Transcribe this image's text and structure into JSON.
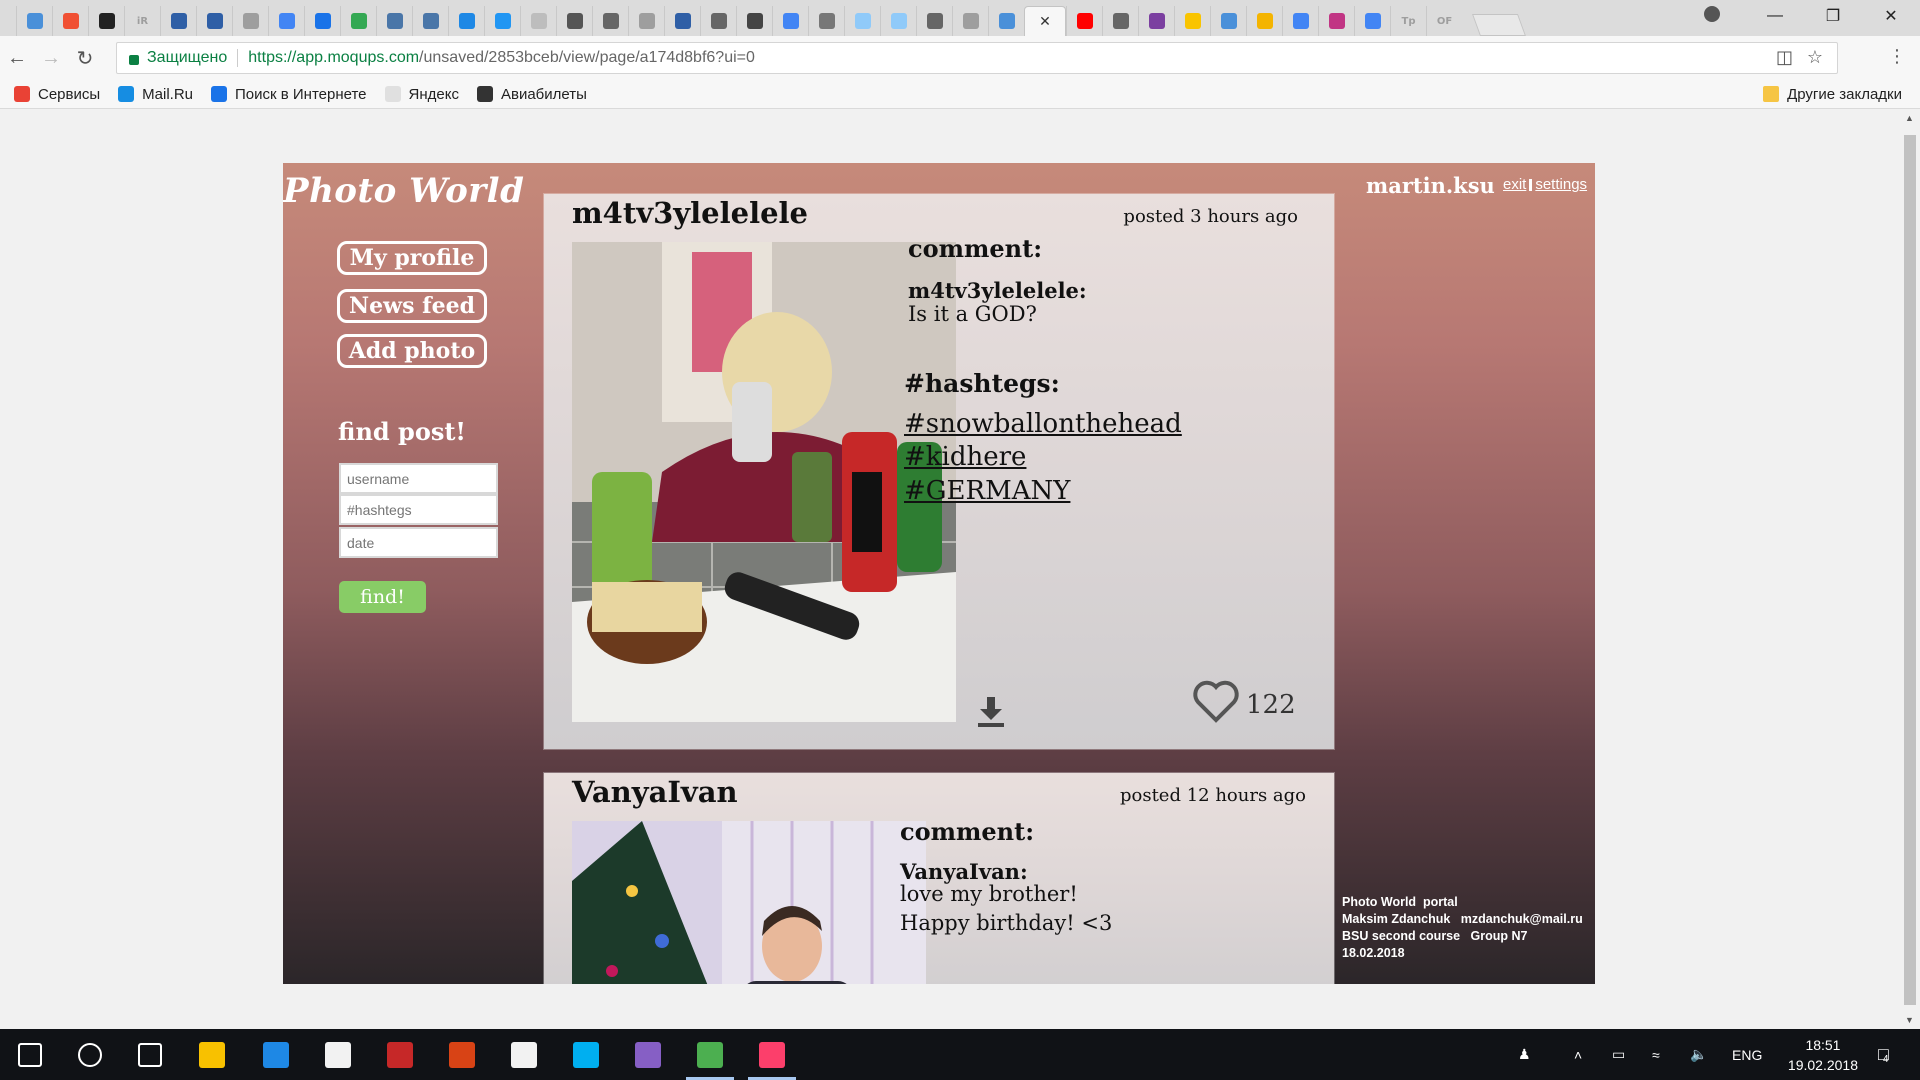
{
  "browser": {
    "tabs": [
      {
        "icon": "layout-icon",
        "color": "#4a90d9"
      },
      {
        "icon": "git-icon",
        "color": "#f05033"
      },
      {
        "icon": "github-icon",
        "color": "#222222"
      },
      {
        "icon": "ir-icon",
        "color": "#9e9e9e"
      },
      {
        "icon": "doc-icon",
        "color": "#2f5fa6"
      },
      {
        "icon": "doc-icon",
        "color": "#2f5fa6"
      },
      {
        "icon": "cloud-icon",
        "color": "#9e9e9e"
      },
      {
        "icon": "translate-icon",
        "color": "#4285f4"
      },
      {
        "icon": "chat-icon",
        "color": "#1a73e8"
      },
      {
        "icon": "drive-icon",
        "color": "#34a853"
      },
      {
        "icon": "vk-icon",
        "color": "#4a76a8"
      },
      {
        "icon": "vk-icon",
        "color": "#4a76a8"
      },
      {
        "icon": "mail-icon",
        "color": "#1e88e5"
      },
      {
        "icon": "m-icon",
        "color": "#2196f3"
      },
      {
        "icon": "h-icon",
        "color": "#bdbdbd"
      },
      {
        "icon": "wiki-icon",
        "color": "#555555"
      },
      {
        "icon": "doc-icon",
        "color": "#666666"
      },
      {
        "icon": "file-icon",
        "color": "#9e9e9e"
      },
      {
        "icon": "doc-icon",
        "color": "#2f5fa6"
      },
      {
        "icon": "image-icon",
        "color": "#666666"
      },
      {
        "icon": "ut-icon",
        "color": "#444444"
      },
      {
        "icon": "google-icon",
        "color": "#4285f4"
      },
      {
        "icon": "ie-icon",
        "color": "#777777"
      },
      {
        "icon": "h-icon",
        "color": "#90caf9"
      },
      {
        "icon": "h-icon",
        "color": "#90caf9"
      },
      {
        "icon": "doc-icon",
        "color": "#666666"
      },
      {
        "icon": "network-icon",
        "color": "#9e9e9e"
      },
      {
        "icon": "network-icon",
        "color": "#4a90d9"
      },
      {
        "icon": "close-icon",
        "color": "#333333",
        "active": true
      },
      {
        "icon": "youtube-icon",
        "color": "#ff0000"
      },
      {
        "icon": "wp-icon",
        "color": "#666666"
      },
      {
        "icon": "film-icon",
        "color": "#7b3fa0"
      },
      {
        "icon": "star-badge-icon",
        "color": "#f9c400"
      },
      {
        "icon": "grid-icon",
        "color": "#4a90d9"
      },
      {
        "icon": "map-icon",
        "color": "#f4b400"
      },
      {
        "icon": "google-icon",
        "color": "#4285f4"
      },
      {
        "icon": "instagram-icon",
        "color": "#c13584"
      },
      {
        "icon": "google-icon",
        "color": "#4285f4"
      },
      {
        "icon": "tp-icon",
        "color": "#9e9e9e"
      },
      {
        "icon": "of-icon",
        "color": "#9e9e9e"
      }
    ],
    "tab_texts": {
      "tp": "Tp",
      "of": "OF",
      "ir": "iR"
    },
    "secure_label": "Защищено",
    "url_host": "https://app.moqups.com",
    "url_path": "/unsaved/2853bceb/view/page/a174d8bf6?ui=0",
    "bookmarks": [
      {
        "label": "Сервисы",
        "icon": "apps-icon",
        "color": "#e94235"
      },
      {
        "label": "Mail.Ru",
        "icon": "mailru-icon",
        "color": "#168de2"
      },
      {
        "label": "Поиск в Интернете",
        "icon": "search-icon",
        "color": "#1a73e8"
      },
      {
        "label": "Яндекс",
        "icon": "yandex-icon",
        "color": "#e0e0e0"
      },
      {
        "label": "Авиабилеты",
        "icon": "plane-icon",
        "color": "#333333"
      }
    ],
    "other_bookmarks": "Другие закладки"
  },
  "app": {
    "logo": "Photo World",
    "nav": [
      "My profile",
      "News feed",
      "Add photo"
    ],
    "find_title": "find post!",
    "find_placeholders": {
      "username": "username",
      "hashtags": "#hashtegs",
      "date": "date"
    },
    "find_button": "find!",
    "current_user": "martin.ksu",
    "links": {
      "exit": "exit",
      "settings": "settings"
    },
    "posts": [
      {
        "author": "m4tv3ylelelele",
        "posted": "posted 3 hours ago",
        "comment_title": "comment:",
        "comment_author": "m4tv3ylelelele:",
        "comment_text": "Is it a GOD?",
        "hashtags_title": "#hashtegs:",
        "hashtags": [
          "#snowballonthehead",
          "#kidhere",
          "#GERMANY"
        ],
        "likes": "122"
      },
      {
        "author": "VanyaIvan",
        "posted": "posted 12 hours ago",
        "comment_title": "comment:",
        "comment_author": "VanyaIvan:",
        "comment_text": "love my brother!\nHappy birthday! <3"
      }
    ],
    "footer": "Photo World  portal\nMaksim Zdanchuk   mzdanchuk@mail.ru\nBSU second course   Group N7\n18.02.2018"
  },
  "taskbar": {
    "apps": [
      {
        "name": "start-icon"
      },
      {
        "name": "search-icon"
      },
      {
        "name": "task-view-icon"
      },
      {
        "name": "file-explorer-icon",
        "color": "#f8c100"
      },
      {
        "name": "edge-icon",
        "color": "#1e88e5"
      },
      {
        "name": "store-icon",
        "color": "#f2f2f2"
      },
      {
        "name": "reader-icon",
        "color": "#c62828"
      },
      {
        "name": "app-red-icon",
        "color": "#d84315"
      },
      {
        "name": "mail-icon",
        "color": "#f2f2f2"
      },
      {
        "name": "skype-icon",
        "color": "#00aff0"
      },
      {
        "name": "visual-studio-icon",
        "color": "#865fc5"
      },
      {
        "name": "chrome-icon",
        "color": "#4caf50",
        "active": true
      },
      {
        "name": "intellij-icon",
        "color": "#fc3f6b",
        "active": true
      }
    ],
    "language": "ENG",
    "time": "18:51",
    "date": "19.02.2018",
    "notifications": "4"
  }
}
